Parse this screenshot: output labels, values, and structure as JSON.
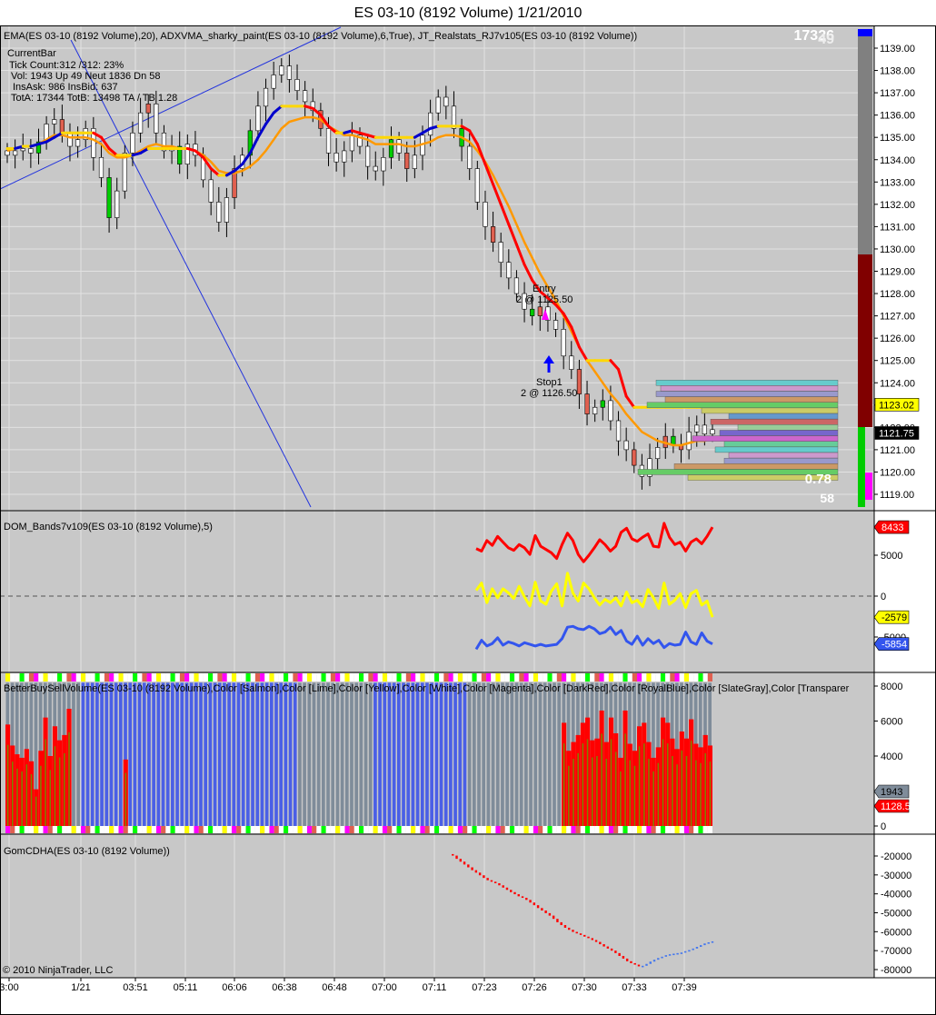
{
  "window": {
    "title": "ES 03-10 (8192 Volume)  1/21/2010",
    "copyright": "© 2010 NinjaTrader, LLC"
  },
  "colors": {
    "background": "#c8c8c8",
    "ema": "#ff9900",
    "adxvma_up": "#0000cc",
    "adxvma_down": "#ff0000",
    "adxvma_flat": "#ffd700",
    "up_candle": "#ffffff",
    "down_candle": "#ffffff",
    "bull_body": "#00cc00",
    "bear_body": "#e06050",
    "dom_upper": "#ff0000",
    "dom_mid": "#ffff00",
    "dom_lower": "#3355ee",
    "hist_blue": "#4a5fe6",
    "hist_gray": "#7f8c9a",
    "hist_red": "#ff0000",
    "hist_olive": "#808000",
    "gom_red": "#ff0000",
    "gom_blue": "#4477ee"
  },
  "chart_data": [
    {
      "type": "candlestick",
      "panel": "price",
      "legend": "EMA(ES 03-10 (8192 Volume),20), ADXVMA_sharky_paint(ES 03-10 (8192 Volume),6,True), JT_Realstats_RJ7v105(ES 03-10 (8192 Volume))",
      "ylim": [
        1118.5,
        1139.5
      ],
      "y_ticks": [
        "1139.00",
        "1138.00",
        "1137.00",
        "1136.00",
        "1135.00",
        "1134.00",
        "1133.00",
        "1132.00",
        "1131.00",
        "1130.00",
        "1129.00",
        "1128.00",
        "1127.00",
        "1126.00",
        "1125.00",
        "1124.00",
        "1123.00",
        "1122.00",
        "1121.00",
        "1120.00",
        "1119.00"
      ],
      "x_ticks": [
        "3:00",
        "1/21",
        "03:51",
        "05:11",
        "06:06",
        "06:38",
        "06:48",
        "07:00",
        "07:11",
        "07:23",
        "07:26",
        "07:30",
        "07:33",
        "07:39"
      ],
      "close_path": [
        1134.2,
        1134.4,
        1134.5,
        1134.3,
        1134.8,
        1135.6,
        1135.8,
        1135.2,
        1134.6,
        1134.9,
        1135.4,
        1134.1,
        1133.2,
        1131.4,
        1132.6,
        1134.3,
        1135.2,
        1136.1,
        1136.5,
        1135.2,
        1134.4,
        1134.6,
        1133.8,
        1134.7,
        1134.2,
        1133.1,
        1132.1,
        1131.2,
        1132.3,
        1133.6,
        1134.2,
        1135.3,
        1136.4,
        1137.2,
        1137.8,
        1138.2,
        1137.6,
        1137.1,
        1136.6,
        1136.2,
        1135.4,
        1134.3,
        1133.9,
        1134.4,
        1135.1,
        1134.6,
        1133.7,
        1133.5,
        1134.1,
        1134.9,
        1134.3,
        1133.6,
        1134.2,
        1135.1,
        1136.1,
        1136.8,
        1136.4,
        1135.4,
        1134.6,
        1133.6,
        1132.1,
        1131.0,
        1130.3,
        1129.4,
        1128.7,
        1128.0,
        1127.3,
        1127.0,
        1127.4,
        1126.8,
        1126.4,
        1125.2,
        1124.6,
        1123.5,
        1122.6,
        1122.9,
        1123.2,
        1122.3,
        1121.4,
        1121.0,
        1120.3,
        1119.8,
        1120.6,
        1121.1,
        1121.6,
        1121.2,
        1121.0,
        1121.8,
        1122.1,
        1121.7,
        1121.9
      ],
      "ema": [
        1134.4,
        1134.5,
        1134.6,
        1134.6,
        1134.7,
        1134.9,
        1135.1,
        1135.1,
        1135.0,
        1135.0,
        1135.0,
        1134.9,
        1134.7,
        1134.3,
        1134.1,
        1134.1,
        1134.2,
        1134.4,
        1134.6,
        1134.7,
        1134.6,
        1134.6,
        1134.5,
        1134.5,
        1134.4,
        1134.2,
        1133.9,
        1133.5,
        1133.4,
        1133.4,
        1133.5,
        1133.7,
        1134.0,
        1134.4,
        1134.9,
        1135.4,
        1135.7,
        1135.8,
        1135.9,
        1135.9,
        1135.8,
        1135.5,
        1135.3,
        1135.1,
        1135.1,
        1135.0,
        1134.9,
        1134.7,
        1134.7,
        1134.7,
        1134.7,
        1134.6,
        1134.6,
        1134.7,
        1134.8,
        1135.0,
        1135.1,
        1135.1,
        1135.0,
        1134.8,
        1134.4,
        1133.9,
        1133.3,
        1132.6,
        1131.9,
        1131.1,
        1130.3,
        1129.6,
        1128.9,
        1128.3,
        1127.7,
        1127.0,
        1126.3,
        1125.6,
        1125.0,
        1124.5,
        1124.0,
        1123.5,
        1123.1,
        1122.6,
        1122.2,
        1121.8,
        1121.6,
        1121.4,
        1121.3,
        1121.2,
        1121.2,
        1121.3,
        1121.4,
        1121.4,
        1121.5
      ],
      "adxvma": [
        1134.5,
        1134.5,
        1134.6,
        1134.6,
        1134.7,
        1134.8,
        1135.0,
        1135.2,
        1135.2,
        1135.2,
        1135.2,
        1135.2,
        1135.0,
        1134.5,
        1134.2,
        1134.2,
        1134.2,
        1134.3,
        1134.5,
        1134.5,
        1134.5,
        1134.5,
        1134.5,
        1134.5,
        1134.4,
        1134.1,
        1133.6,
        1133.3,
        1133.3,
        1133.5,
        1133.8,
        1134.3,
        1135.0,
        1135.6,
        1136.1,
        1136.4,
        1136.4,
        1136.4,
        1136.4,
        1136.3,
        1136.0,
        1135.5,
        1135.2,
        1135.2,
        1135.3,
        1135.2,
        1135.1,
        1135.0,
        1135.0,
        1135.0,
        1135.0,
        1135.0,
        1135.0,
        1135.2,
        1135.4,
        1135.5,
        1135.5,
        1135.5,
        1135.5,
        1135.3,
        1134.7,
        1133.8,
        1132.9,
        1132.0,
        1131.1,
        1130.2,
        1129.3,
        1128.6,
        1128.1,
        1127.8,
        1127.5,
        1127.1,
        1126.5,
        1125.6,
        1125.0,
        1125.0,
        1125.0,
        1125.0,
        1124.6,
        1123.4,
        1122.9,
        1122.9,
        1122.9,
        1122.9,
        1122.9,
        1122.9,
        1122.9,
        1122.9,
        1122.9,
        1122.9,
        1122.9
      ],
      "annotations": {
        "entry_label": "Entry",
        "entry_detail": "2 @ 1125.50",
        "stop_label": "Stop1",
        "stop_detail": "2 @ 1126.50"
      },
      "current_bar": {
        "header": "CurrentBar",
        "tick_count": "Tick Count:312 /312: 23%",
        "vol": "Vol: 1943   Up 49  Neut  1836   Dn 58",
        "ins": "InsAsk: 986   InsBid: 637",
        "tot": "TotA: 17344  TotB: 13498   TA / TB 1.28"
      },
      "top_right_counter_a": "17326",
      "top_right_counter_b": "49",
      "ratio_label": "0.78",
      "bottom_count": "58",
      "price_markers": [
        "1123.02",
        "1121.75"
      ]
    },
    {
      "type": "line",
      "panel": "dom",
      "legend": "DOM_Bands7v109(ES 03-10 (8192 Volume),5)",
      "ylim": [
        -8000,
        10000
      ],
      "y_ticks": [
        "5000",
        "0",
        "-5000"
      ],
      "series": [
        {
          "name": "upper",
          "values": [
            5800,
            5500,
            6800,
            6200,
            7300,
            6600,
            5900,
            5600,
            6300,
            5900,
            5100,
            7400,
            6100,
            5700,
            5300,
            4600,
            6300,
            7700,
            6800,
            5100,
            4200,
            5000,
            5900,
            6900,
            6300,
            5500,
            6100,
            7800,
            8300,
            7000,
            6700,
            7200,
            7600,
            6100,
            6000,
            8900,
            7200,
            6300,
            6600,
            5500,
            6600,
            7000,
            6400,
            7300,
            8433
          ]
        },
        {
          "name": "middle",
          "values": [
            700,
            1600,
            -800,
            900,
            -200,
            900,
            400,
            -300,
            1200,
            -100,
            -1200,
            1700,
            -600,
            -1000,
            600,
            1500,
            -1200,
            2800,
            400,
            -600,
            1600,
            900,
            -200,
            -1100,
            -400,
            -800,
            -200,
            -1200,
            500,
            -800,
            -500,
            -1300,
            800,
            -200,
            -1500,
            1600,
            -1000,
            -500,
            300,
            -1400,
            300,
            700,
            -1100,
            -600,
            -2579
          ]
        },
        {
          "name": "lower",
          "values": [
            -6500,
            -5400,
            -6100,
            -5800,
            -5100,
            -6000,
            -5600,
            -5800,
            -6100,
            -5700,
            -5900,
            -6100,
            -5900,
            -6100,
            -6000,
            -5900,
            -5200,
            -3800,
            -3700,
            -4000,
            -4100,
            -3700,
            -4000,
            -4600,
            -4400,
            -3800,
            -4700,
            -4200,
            -5500,
            -5900,
            -4900,
            -6000,
            -5200,
            -5800,
            -5400,
            -6300,
            -5800,
            -6000,
            -5900,
            -4400,
            -5600,
            -5900,
            -4500,
            -5500,
            -5854
          ]
        }
      ],
      "markers": [
        "8433",
        "-2579",
        "-5854"
      ]
    },
    {
      "type": "bar",
      "panel": "volume",
      "legend": "BetterBuySellVolume(ES 03-10 (8192 Volume),Color [Salmon],Color [Lime],Color [Yellow],Color [White],Color [Magenta],Color [DarkRed],Color [RoyalBlue],Color [SlateGray],Color [Transparer",
      "ylim": [
        0,
        8500
      ],
      "y_ticks": [
        "8000",
        "6000",
        "4000",
        "2000",
        "0"
      ],
      "total_height": 8192,
      "red_values": [
        5800,
        4600,
        4100,
        3900,
        4400,
        3700,
        2100,
        4300,
        6200,
        4000,
        5700,
        4900,
        5200,
        6700,
        3800,
        5900,
        4300,
        4800,
        5200,
        5900,
        6200,
        4900,
        5000,
        6600,
        4800,
        6200,
        5300,
        3900,
        6600,
        4700,
        4300,
        5700,
        5900,
        4800,
        3900,
        4500,
        6200,
        5900,
        5000,
        4400,
        5400,
        5000,
        6100,
        4700,
        4500,
        5200,
        4600
      ],
      "markers": [
        "1943",
        "1128.5"
      ]
    },
    {
      "type": "line",
      "panel": "gom",
      "legend": "GomCDHA(ES 03-10 (8192 Volume))",
      "ylim": [
        -80000,
        -14000
      ],
      "y_ticks": [
        "-20000",
        "-30000",
        "-40000",
        "-50000",
        "-60000",
        "-70000",
        "-80000"
      ],
      "values": [
        -19000,
        -19800,
        -21500,
        -23000,
        -24500,
        -26000,
        -27500,
        -28800,
        -30200,
        -31600,
        -32800,
        -33600,
        -34400,
        -35500,
        -36700,
        -37900,
        -39100,
        -40200,
        -41300,
        -42100,
        -43200,
        -44600,
        -46000,
        -47500,
        -48800,
        -50200,
        -51500,
        -53200,
        -55000,
        -56500,
        -57900,
        -59000,
        -60100,
        -60900,
        -61700,
        -62600,
        -63400,
        -64400,
        -65400,
        -66600,
        -67800,
        -68900,
        -70000,
        -71300,
        -72800,
        -74200,
        -75600,
        -76600,
        -77400,
        -78300,
        -78000,
        -77000,
        -75800,
        -74800,
        -73900,
        -73200,
        -72400,
        -71900,
        -71600,
        -71300,
        -71000,
        -70300,
        -69700,
        -68900,
        -68000,
        -67100,
        -66200,
        -65600,
        -65100
      ]
    }
  ]
}
